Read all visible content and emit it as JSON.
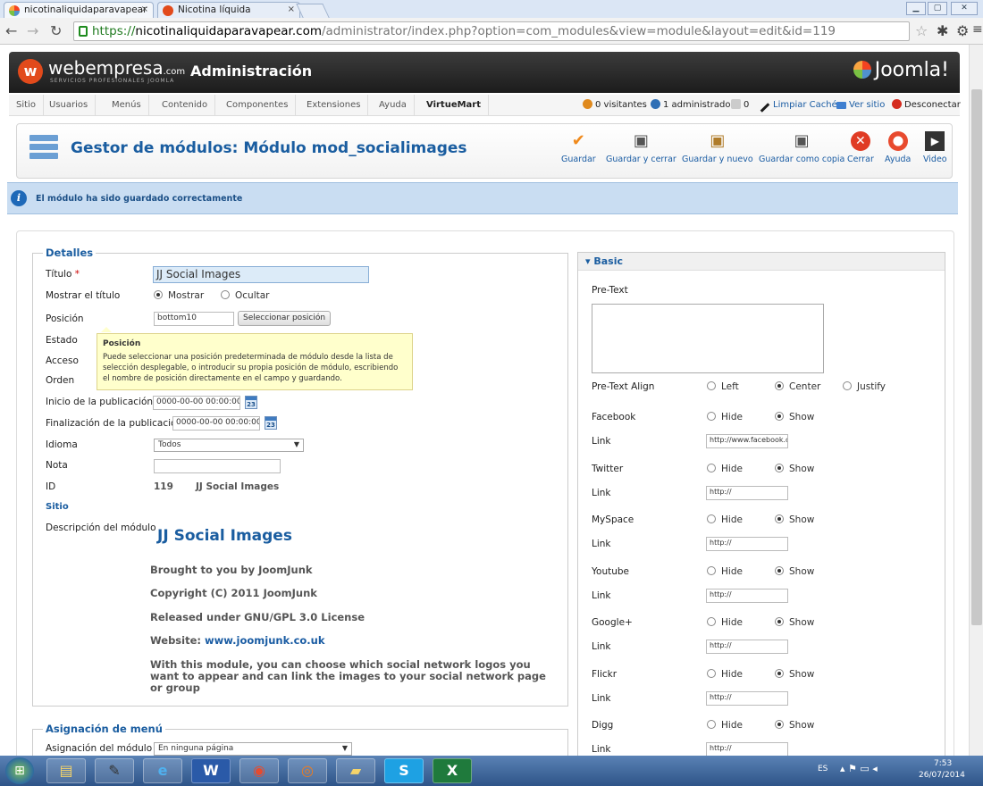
{
  "browser": {
    "tabs": [
      {
        "title": "nicotinaliquidaparavapear",
        "close": "×"
      },
      {
        "title": "Nicotina líquida",
        "close": "×"
      }
    ],
    "url": {
      "scheme": "https://",
      "host": "nicotinaliquidaparavapear.com",
      "path": "/administrator/index.php?option=com_modules&view=module&layout=edit&id=119"
    },
    "window_controls": {
      "minimize": "▁",
      "maximize": "▢",
      "close": "✕"
    }
  },
  "header": {
    "brand": "webempresa",
    "brand_suffix": ".com",
    "brand_sub": "SERVICIOS PROFESIONALES JOOMLA",
    "title": "Administración",
    "joomla_logo": "Joomla!"
  },
  "menu": {
    "items": [
      "Sitio",
      "Usuarios",
      "Menús",
      "Contenido",
      "Componentes",
      "Extensiones",
      "Ayuda",
      "VirtueMart"
    ],
    "status": {
      "visitors": "0 visitantes",
      "admins": "1 administrador",
      "messages": "0",
      "clear_cache": "Limpiar Caché",
      "view_site": "Ver sitio",
      "logout": "Desconectar"
    }
  },
  "toolbar": {
    "title": "Gestor de módulos: Módulo mod_socialimages",
    "buttons": [
      {
        "label": "Guardar",
        "icon": "check-icon"
      },
      {
        "label": "Guardar y cerrar",
        "icon": "save-close-icon"
      },
      {
        "label": "Guardar y nuevo",
        "icon": "save-new-icon"
      },
      {
        "label": "Guardar como copia",
        "icon": "save-copy-icon"
      },
      {
        "label": "Cerrar",
        "icon": "close-icon"
      },
      {
        "label": "Ayuda",
        "icon": "help-icon"
      },
      {
        "label": "Video",
        "icon": "video-icon"
      }
    ]
  },
  "message": "El módulo ha sido guardado correctamente",
  "details": {
    "legend": "Detalles",
    "title_label": "Título",
    "required": "*",
    "title_value": "JJ Social Images",
    "show_title_label": "Mostrar el título",
    "show": "Mostrar",
    "hide": "Ocultar",
    "position_label": "Posición",
    "position_value": "bottom10",
    "select_position": "Seleccionar posición",
    "state_label": "Estado",
    "access_label": "Acceso",
    "order_label": "Orden",
    "publish_up_label": "Inicio de la publicación",
    "publish_up_value": "0000-00-00 00:00:00",
    "publish_down_label": "Finalización de la publicación",
    "publish_down_value": "0000-00-00 00:00:00",
    "calendar_day": "23",
    "language_label": "Idioma",
    "language_value": "Todos",
    "note_label": "Nota",
    "note_value": "",
    "id_label": "ID",
    "id_value": "119",
    "id_name": "JJ Social Images",
    "site": "Sitio",
    "description_label": "Descripción del módulo",
    "tooltip_title": "Posición",
    "tooltip_text": "Puede seleccionar una posición predeterminada de módulo desde la lista de selección desplegable, o introducir su propia posición de módulo, escribiendo el nombre de posición directamente en el campo y guardando."
  },
  "description": {
    "heading": "JJ Social Images",
    "line1": "Brought to you by JoomJunk",
    "line2": "Copyright (C) 2011 JoomJunk",
    "line3": "Released under GNU/GPL 3.0 License",
    "website_label": "Website:",
    "website": "www.joomjunk.co.uk",
    "line5": "With this module, you can choose which social network logos you want to appear and can link the images to your social network page or group"
  },
  "menu_assignment": {
    "legend": "Asignación de menú",
    "label": "Asignación del módulo",
    "value": "En ninguna página"
  },
  "basic": {
    "title": "Basic",
    "pretext_label": "Pre-Text",
    "pretext_value": "",
    "align_label": "Pre-Text Align",
    "align_options": [
      "Left",
      "Center",
      "Justify"
    ],
    "align_selected": "Center",
    "hide": "Hide",
    "show": "Show",
    "link_label": "Link",
    "networks": [
      {
        "name": "Facebook",
        "link": "http://www.facebook.c",
        "state": "Show"
      },
      {
        "name": "Twitter",
        "link": "http://",
        "state": "Show"
      },
      {
        "name": "MySpace",
        "link": "http://",
        "state": "Show"
      },
      {
        "name": "Youtube",
        "link": "http://",
        "state": "Show"
      },
      {
        "name": "Google+",
        "link": "http://",
        "state": "Show"
      },
      {
        "name": "Flickr",
        "link": "http://",
        "state": "Show"
      },
      {
        "name": "Digg",
        "link": "http://",
        "state": "Show"
      }
    ]
  },
  "taskbar": {
    "apps": [
      "explorer-icon",
      "gimp-icon",
      "ie-icon",
      "word-icon",
      "chrome-icon",
      "firefox-icon",
      "folder-icon",
      "skype-icon",
      "excel-icon"
    ],
    "lang": "ES",
    "time": "7:53",
    "date": "26/07/2014"
  }
}
